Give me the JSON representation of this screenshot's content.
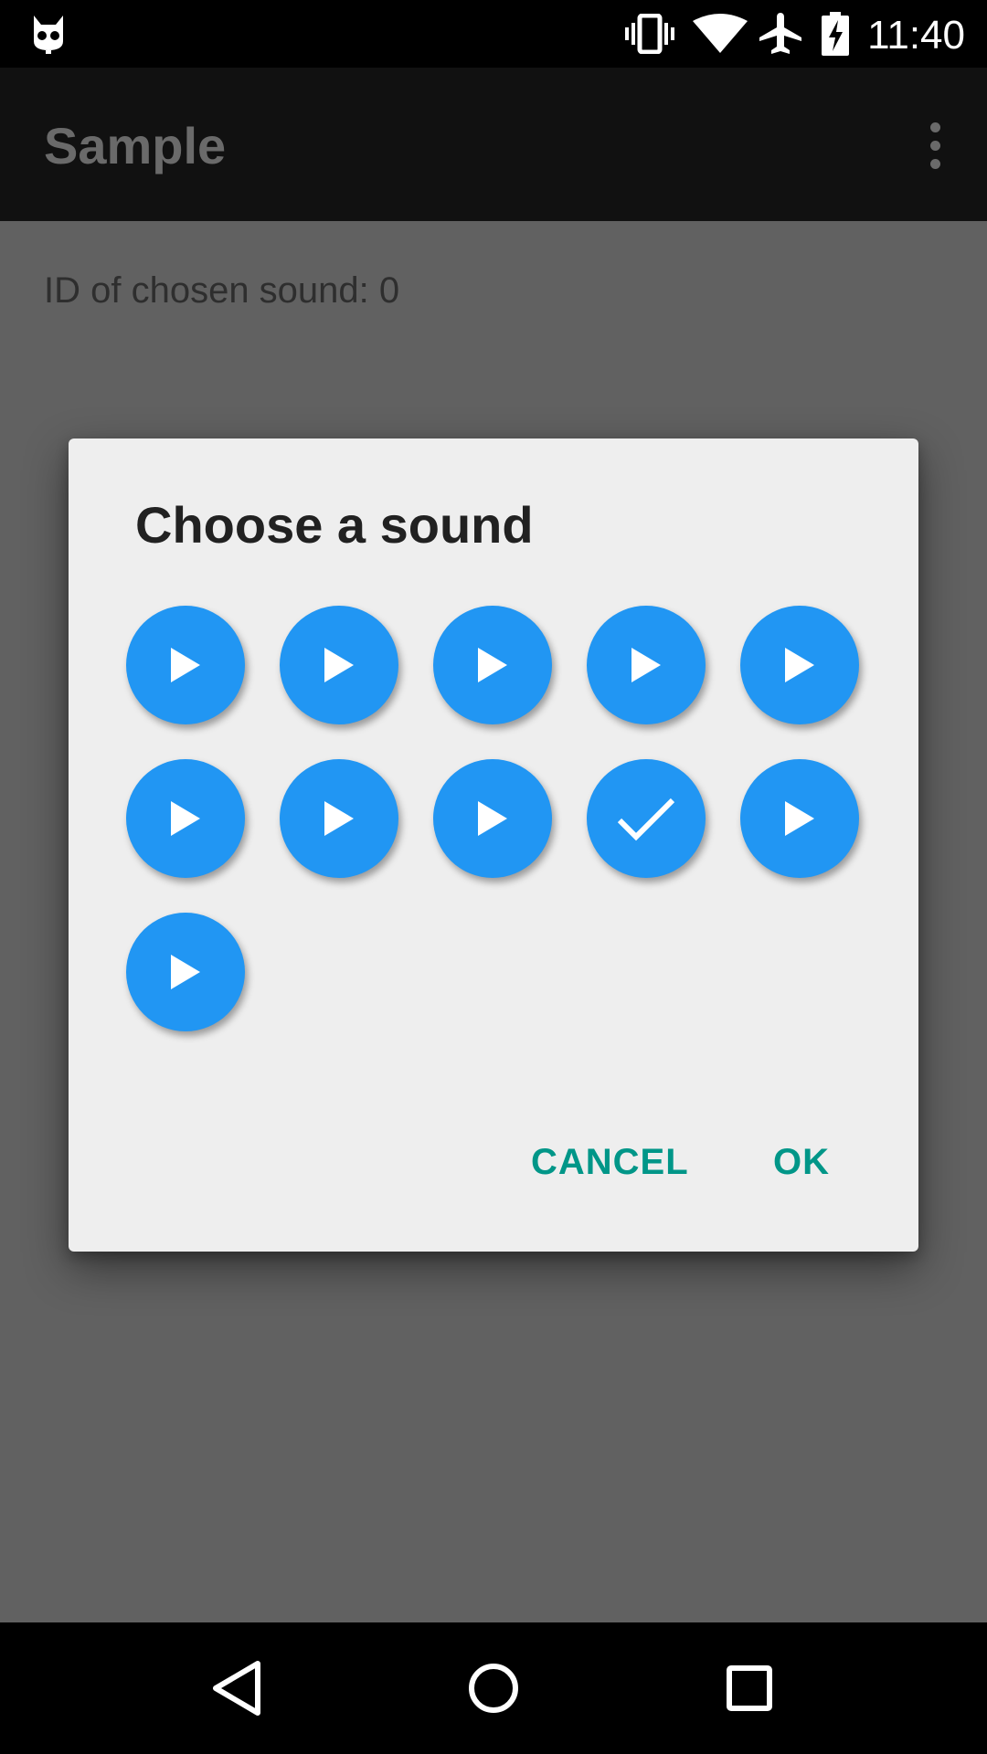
{
  "status_bar": {
    "time": "11:40",
    "icons": [
      "cyanogen-mascot-icon",
      "vibrate-icon",
      "wifi-icon",
      "airplane-mode-icon",
      "battery-charging-icon"
    ]
  },
  "app_bar": {
    "title": "Sample",
    "menu_icon": "overflow-menu-icon"
  },
  "content": {
    "chosen_sound_text": "ID of chosen sound: 0"
  },
  "dialog": {
    "title": "Choose a sound",
    "sounds": [
      {
        "state": "play",
        "icon": "play-icon"
      },
      {
        "state": "play",
        "icon": "play-icon"
      },
      {
        "state": "play",
        "icon": "play-icon"
      },
      {
        "state": "play",
        "icon": "play-icon"
      },
      {
        "state": "play",
        "icon": "play-icon"
      },
      {
        "state": "play",
        "icon": "play-icon"
      },
      {
        "state": "play",
        "icon": "play-icon"
      },
      {
        "state": "play",
        "icon": "play-icon"
      },
      {
        "state": "selected",
        "icon": "check-icon"
      },
      {
        "state": "play",
        "icon": "play-icon"
      },
      {
        "state": "play",
        "icon": "play-icon"
      }
    ],
    "cancel_label": "CANCEL",
    "ok_label": "OK"
  },
  "nav_bar": {
    "icons": [
      "back-icon",
      "home-icon",
      "recents-icon"
    ]
  },
  "colors": {
    "accent": "#2196f3",
    "action_text": "#009688",
    "scrim_background": "#616161",
    "dialog_background": "#eeeeee"
  }
}
